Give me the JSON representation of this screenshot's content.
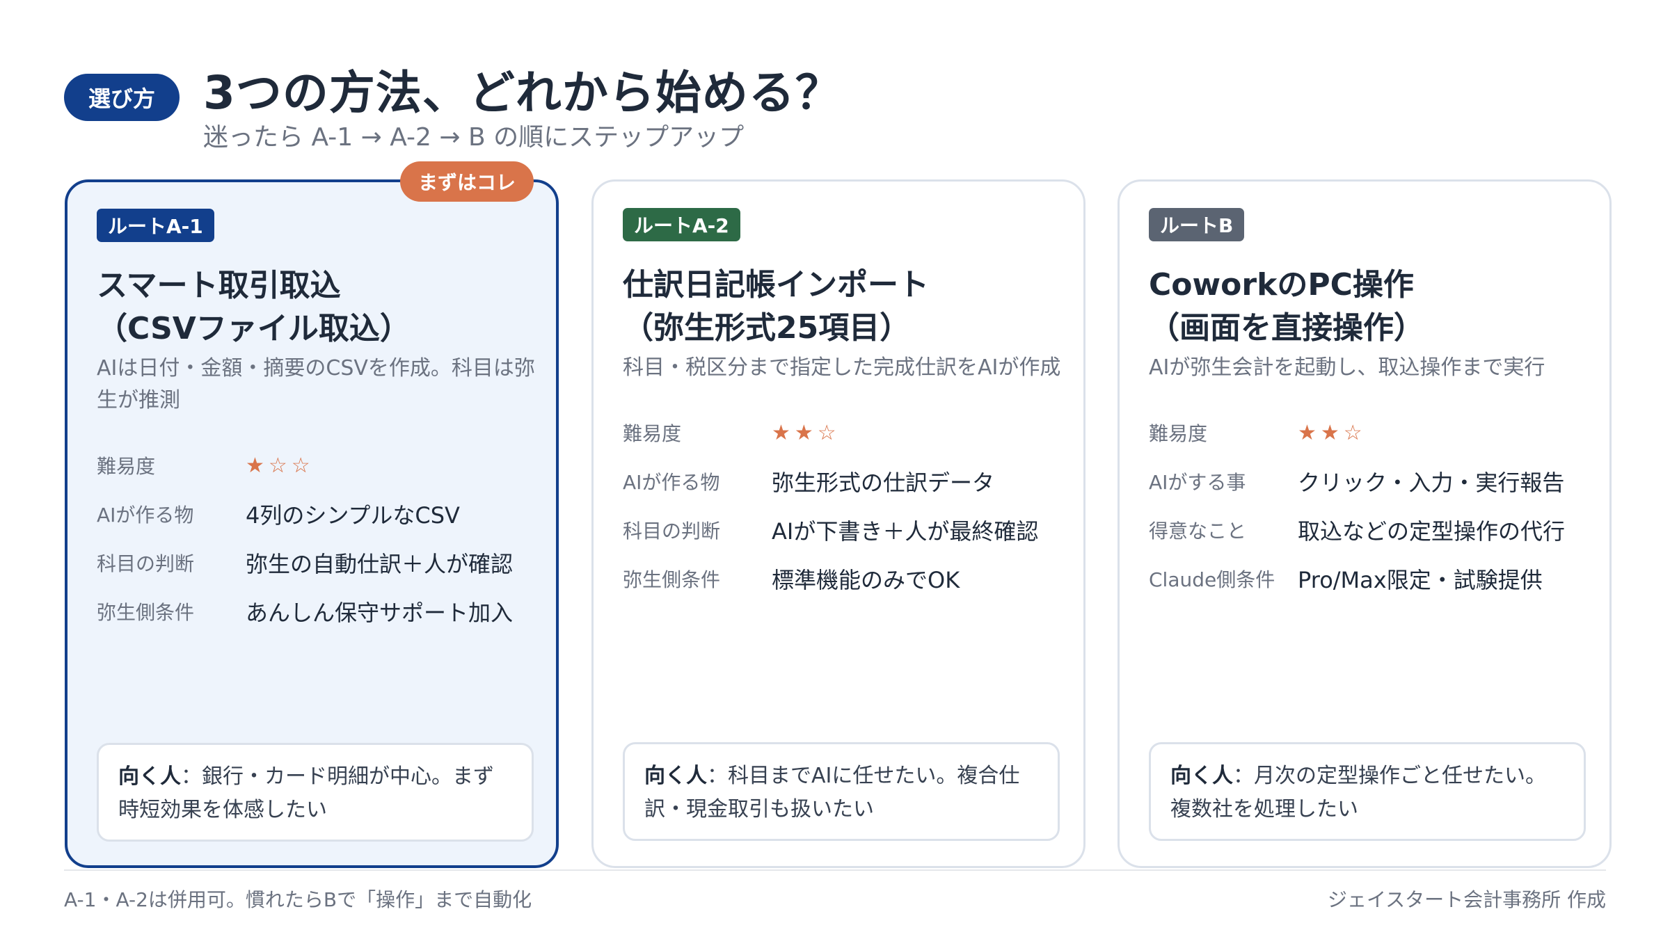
{
  "header": {
    "tag": "選び方",
    "title": "3つの方法、どれから始める？",
    "subtitle": "迷ったら A-1 → A-2 → B の順にステップアップ"
  },
  "colors": {
    "primary": "#123f8c",
    "accent": "#d9744a",
    "green": "#2d6a46",
    "gray": "#5b6472"
  },
  "cards": [
    {
      "badge": "まずはコレ",
      "route": "ルートA-1",
      "route_color": "#123f8c",
      "title_line1": "スマート取引取込",
      "title_line2": "（CSVファイル取込）",
      "desc": "AIは日付・金額・摘要のCSVを作成。科目は弥生が推測",
      "rows": [
        {
          "label": "難易度",
          "value": "★☆☆",
          "difficulty": 1
        },
        {
          "label": "AIが作る物",
          "value": "4列のシンプルなCSV"
        },
        {
          "label": "科目の判断",
          "value": "弥生の自動仕訳＋人が確認"
        },
        {
          "label": "弥生側条件",
          "value": "あんしん保守サポート加入"
        }
      ],
      "fit_label": "向く人",
      "fit_text": "：銀行・カード明細が中心。まず時短効果を体感したい"
    },
    {
      "route": "ルートA-2",
      "route_color": "#2d6a46",
      "title_line1": "仕訳日記帳インポート",
      "title_line2": "（弥生形式25項目）",
      "desc": "科目・税区分まで指定した完成仕訳をAIが作成",
      "rows": [
        {
          "label": "難易度",
          "value": "★★☆",
          "difficulty": 2
        },
        {
          "label": "AIが作る物",
          "value": "弥生形式の仕訳データ"
        },
        {
          "label": "科目の判断",
          "value": "AIが下書き＋人が最終確認"
        },
        {
          "label": "弥生側条件",
          "value": "標準機能のみでOK"
        }
      ],
      "fit_label": "向く人",
      "fit_text": "：科目までAIに任せたい。複合仕訳・現金取引も扱いたい"
    },
    {
      "route": "ルートB",
      "route_color": "#5b6472",
      "title_line1": "CoworkのPC操作",
      "title_line2": "（画面を直接操作）",
      "desc": "AIが弥生会計を起動し、取込操作まで実行",
      "rows": [
        {
          "label": "難易度",
          "value": "★★☆",
          "difficulty": 2
        },
        {
          "label": "AIがする事",
          "value": "クリック・入力・実行報告"
        },
        {
          "label": "得意なこと",
          "value": "取込などの定型操作の代行"
        },
        {
          "label": "Claude側条件",
          "value": "Pro/Max限定・試験提供"
        }
      ],
      "fit_label": "向く人",
      "fit_text": "：月次の定型操作ごと任せたい。複数社を処理したい"
    }
  ],
  "footer": {
    "left": "A-1・A-2は併用可。慣れたらBで「操作」まで自動化",
    "right": "ジェイスタート会計事務所 作成"
  }
}
